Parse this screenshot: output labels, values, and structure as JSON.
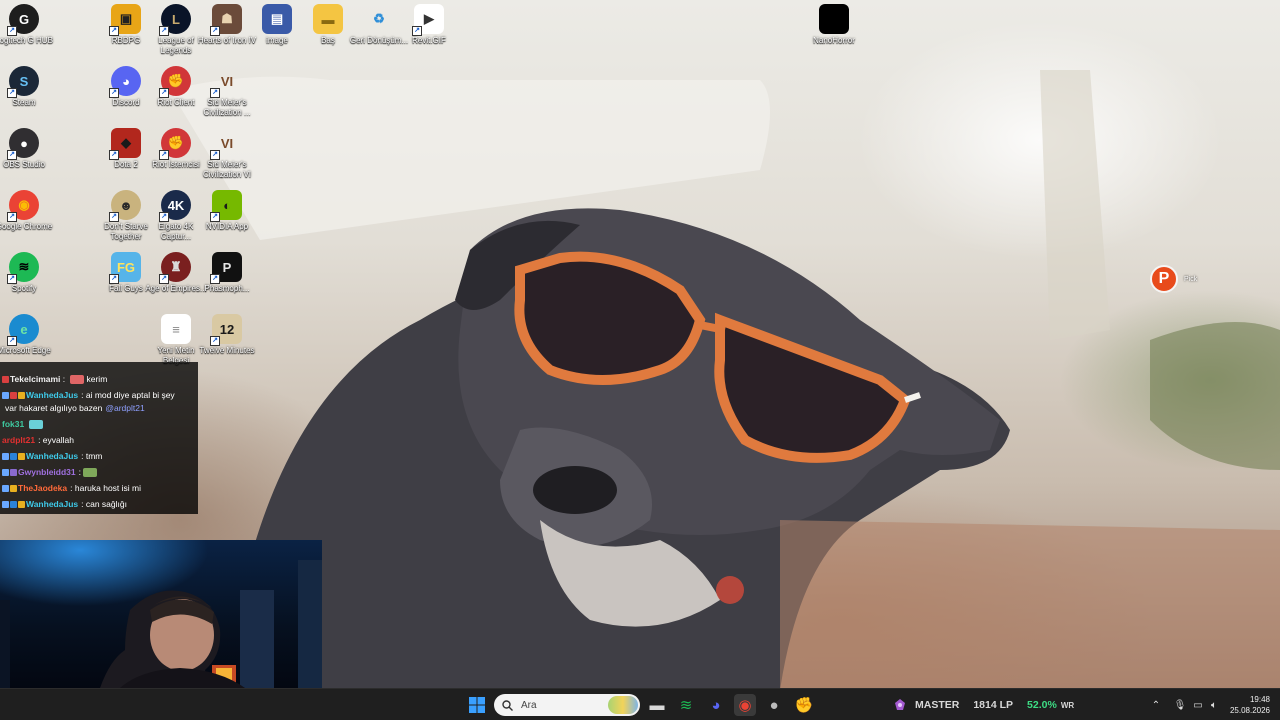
{
  "desktop": {
    "icons": [
      {
        "label": "Logitech G HUB",
        "glyph": "G",
        "bg": "#1e1e1e",
        "fg": "#ffffff",
        "round": true
      },
      {
        "label": "Steam",
        "glyph": "S",
        "bg": "#1b2838",
        "fg": "#66c0f4",
        "round": true
      },
      {
        "label": "OBS Studio",
        "glyph": "●",
        "bg": "#302e31",
        "fg": "#ffffff",
        "round": true
      },
      {
        "label": "Google Chrome",
        "glyph": "◉",
        "bg": "#ea4335",
        "fg": "#fbbc05",
        "round": true
      },
      {
        "label": "Spotify",
        "glyph": "≋",
        "bg": "#1db954",
        "fg": "#000000",
        "round": true
      },
      {
        "label": "Microsoft Edge",
        "glyph": "e",
        "bg": "#1a8bd0",
        "fg": "#6de3a5",
        "round": true
      },
      {
        "label": "RBDPG",
        "glyph": "▣",
        "bg": "#e8a517",
        "fg": "#222222",
        "round": false
      },
      {
        "label": "League of Legends",
        "glyph": "L",
        "bg": "#0a1428",
        "fg": "#c8aa6e",
        "round": true
      },
      {
        "label": "Hearts of Iron IV",
        "glyph": "☗",
        "bg": "#6b4b3a",
        "fg": "#e8d3b0",
        "round": false
      },
      {
        "label": "image",
        "glyph": "▤",
        "bg": "#3a5aa8",
        "fg": "#ffffff",
        "round": false
      },
      {
        "label": "Baş",
        "glyph": "▬",
        "bg": "#f4c542",
        "fg": "#8a6a10",
        "round": false
      },
      {
        "label": "Geri Dönüşüm...",
        "glyph": "♻",
        "bg": "transparent",
        "fg": "#2f8fd8",
        "round": false
      },
      {
        "label": "Revit.GIF",
        "glyph": "▶",
        "bg": "#ffffff",
        "fg": "#333333",
        "round": false
      },
      {
        "label": "Discord",
        "glyph": "◕",
        "bg": "#5865f2",
        "fg": "#ffffff",
        "round": true
      },
      {
        "label": "Riot Client",
        "glyph": "✊",
        "bg": "#d13639",
        "fg": "#ffffff",
        "round": true
      },
      {
        "label": "Sid Meier's Civilization ...",
        "glyph": "VI",
        "bg": "transparent",
        "fg": "#7a4a2a",
        "round": false
      },
      {
        "label": "Dota 2",
        "glyph": "◆",
        "bg": "#b2271d",
        "fg": "#1a1a1a",
        "round": false
      },
      {
        "label": "Riot İstemcisi",
        "glyph": "✊",
        "bg": "#d13639",
        "fg": "#ffffff",
        "round": true
      },
      {
        "label": "Sid Meier's Civilization VI",
        "glyph": "VI",
        "bg": "transparent",
        "fg": "#7a4a2a",
        "round": false
      },
      {
        "label": "Don't Starve Together",
        "glyph": "☻",
        "bg": "#c9b37e",
        "fg": "#2a2a2a",
        "round": true
      },
      {
        "label": "Elgato 4K Captur...",
        "glyph": "4K",
        "bg": "#1a2a4a",
        "fg": "#ffffff",
        "round": true
      },
      {
        "label": "NVIDIA App",
        "glyph": "◐",
        "bg": "#76b900",
        "fg": "#1a1a1a",
        "round": false
      },
      {
        "label": "Fall Guys",
        "glyph": "FG",
        "bg": "#56b4e9",
        "fg": "#ffe45c",
        "round": false
      },
      {
        "label": "Age of Empires...",
        "glyph": "♜",
        "bg": "#7a1f1f",
        "fg": "#d9d9d9",
        "round": true
      },
      {
        "label": "Phasmoph...",
        "glyph": "P",
        "bg": "#111111",
        "fg": "#e6e6e6",
        "round": false
      },
      {
        "label": "Yeni Metin Belgesi",
        "glyph": "≡",
        "bg": "#ffffff",
        "fg": "#888888",
        "round": false
      },
      {
        "label": "Twelve Minutes",
        "glyph": "12",
        "bg": "#d9c9a3",
        "fg": "#1a1a1a",
        "round": false
      },
      {
        "label": "NanoHorror",
        "glyph": "",
        "bg": "#000000",
        "fg": "#ffffff",
        "round": false
      }
    ]
  },
  "chat": {
    "messages": [
      {
        "user": "Tekelcimami",
        "user_color": "#f0f0f0",
        "text": "kerim",
        "badges": [
          "#d94040"
        ],
        "emote": "#e06666"
      },
      {
        "user": "WanhedaJus",
        "user_color": "#3ec9e8",
        "text": ": ai mod diye aptal bi şey",
        "badges": [
          "#6aa8ff",
          "#d94040",
          "#e8b020"
        ]
      },
      {
        "user": "",
        "user_color": "#ffffff",
        "text": "var hakaret algılıyo bazen",
        "mention": "@ardplt21",
        "badges": []
      },
      {
        "user": "fok31",
        "user_color": "#3ec9a0",
        "text": "",
        "badges": [],
        "emote": "#6ad0d8"
      },
      {
        "user": "ardplt21",
        "user_color": "#e03030",
        "text": ": eyvallah",
        "badges": []
      },
      {
        "user": "WanhedaJus",
        "user_color": "#3ec9e8",
        "text": ": tmm",
        "badges": [
          "#6aa8ff",
          "#2a82d9",
          "#e8b020"
        ]
      },
      {
        "user": "Gwynbleidd31",
        "user_color": "#a070e0",
        "text": ":",
        "badges": [
          "#6aa8ff",
          "#8a6ad0"
        ],
        "emote": "#7fa85a"
      },
      {
        "user": "TheJaodeka",
        "user_color": "#ff6a3a",
        "text": ": haruka host isi mi",
        "badges": [
          "#6aa8ff",
          "#e8b020"
        ]
      },
      {
        "user": "WanhedaJus",
        "user_color": "#3ec9e8",
        "text": ": can sağlığı",
        "badges": [
          "#6aa8ff",
          "#2a82d9",
          "#e8b020"
        ]
      }
    ]
  },
  "picpick": {
    "label": "Pick"
  },
  "taskbar": {
    "search_placeholder": "Ara",
    "apps": [
      {
        "name": "file-explorer",
        "glyph": "▬",
        "color": "#d8d8d8"
      },
      {
        "name": "spotify",
        "glyph": "≋",
        "color": "#1db954"
      },
      {
        "name": "discord",
        "glyph": "◕",
        "color": "#5865f2"
      },
      {
        "name": "chrome",
        "glyph": "◉",
        "color": "#ea4335"
      },
      {
        "name": "obs",
        "glyph": "●",
        "color": "#bbbbbb"
      },
      {
        "name": "riot-client",
        "glyph": "✊",
        "color": "#d13639"
      }
    ],
    "rank": {
      "tier": "MASTER",
      "lp": "1814 LP",
      "winrate": "52.0%",
      "wr_label": "WR"
    },
    "clock": {
      "time": "19:48",
      "date": "25.08.2026"
    }
  }
}
